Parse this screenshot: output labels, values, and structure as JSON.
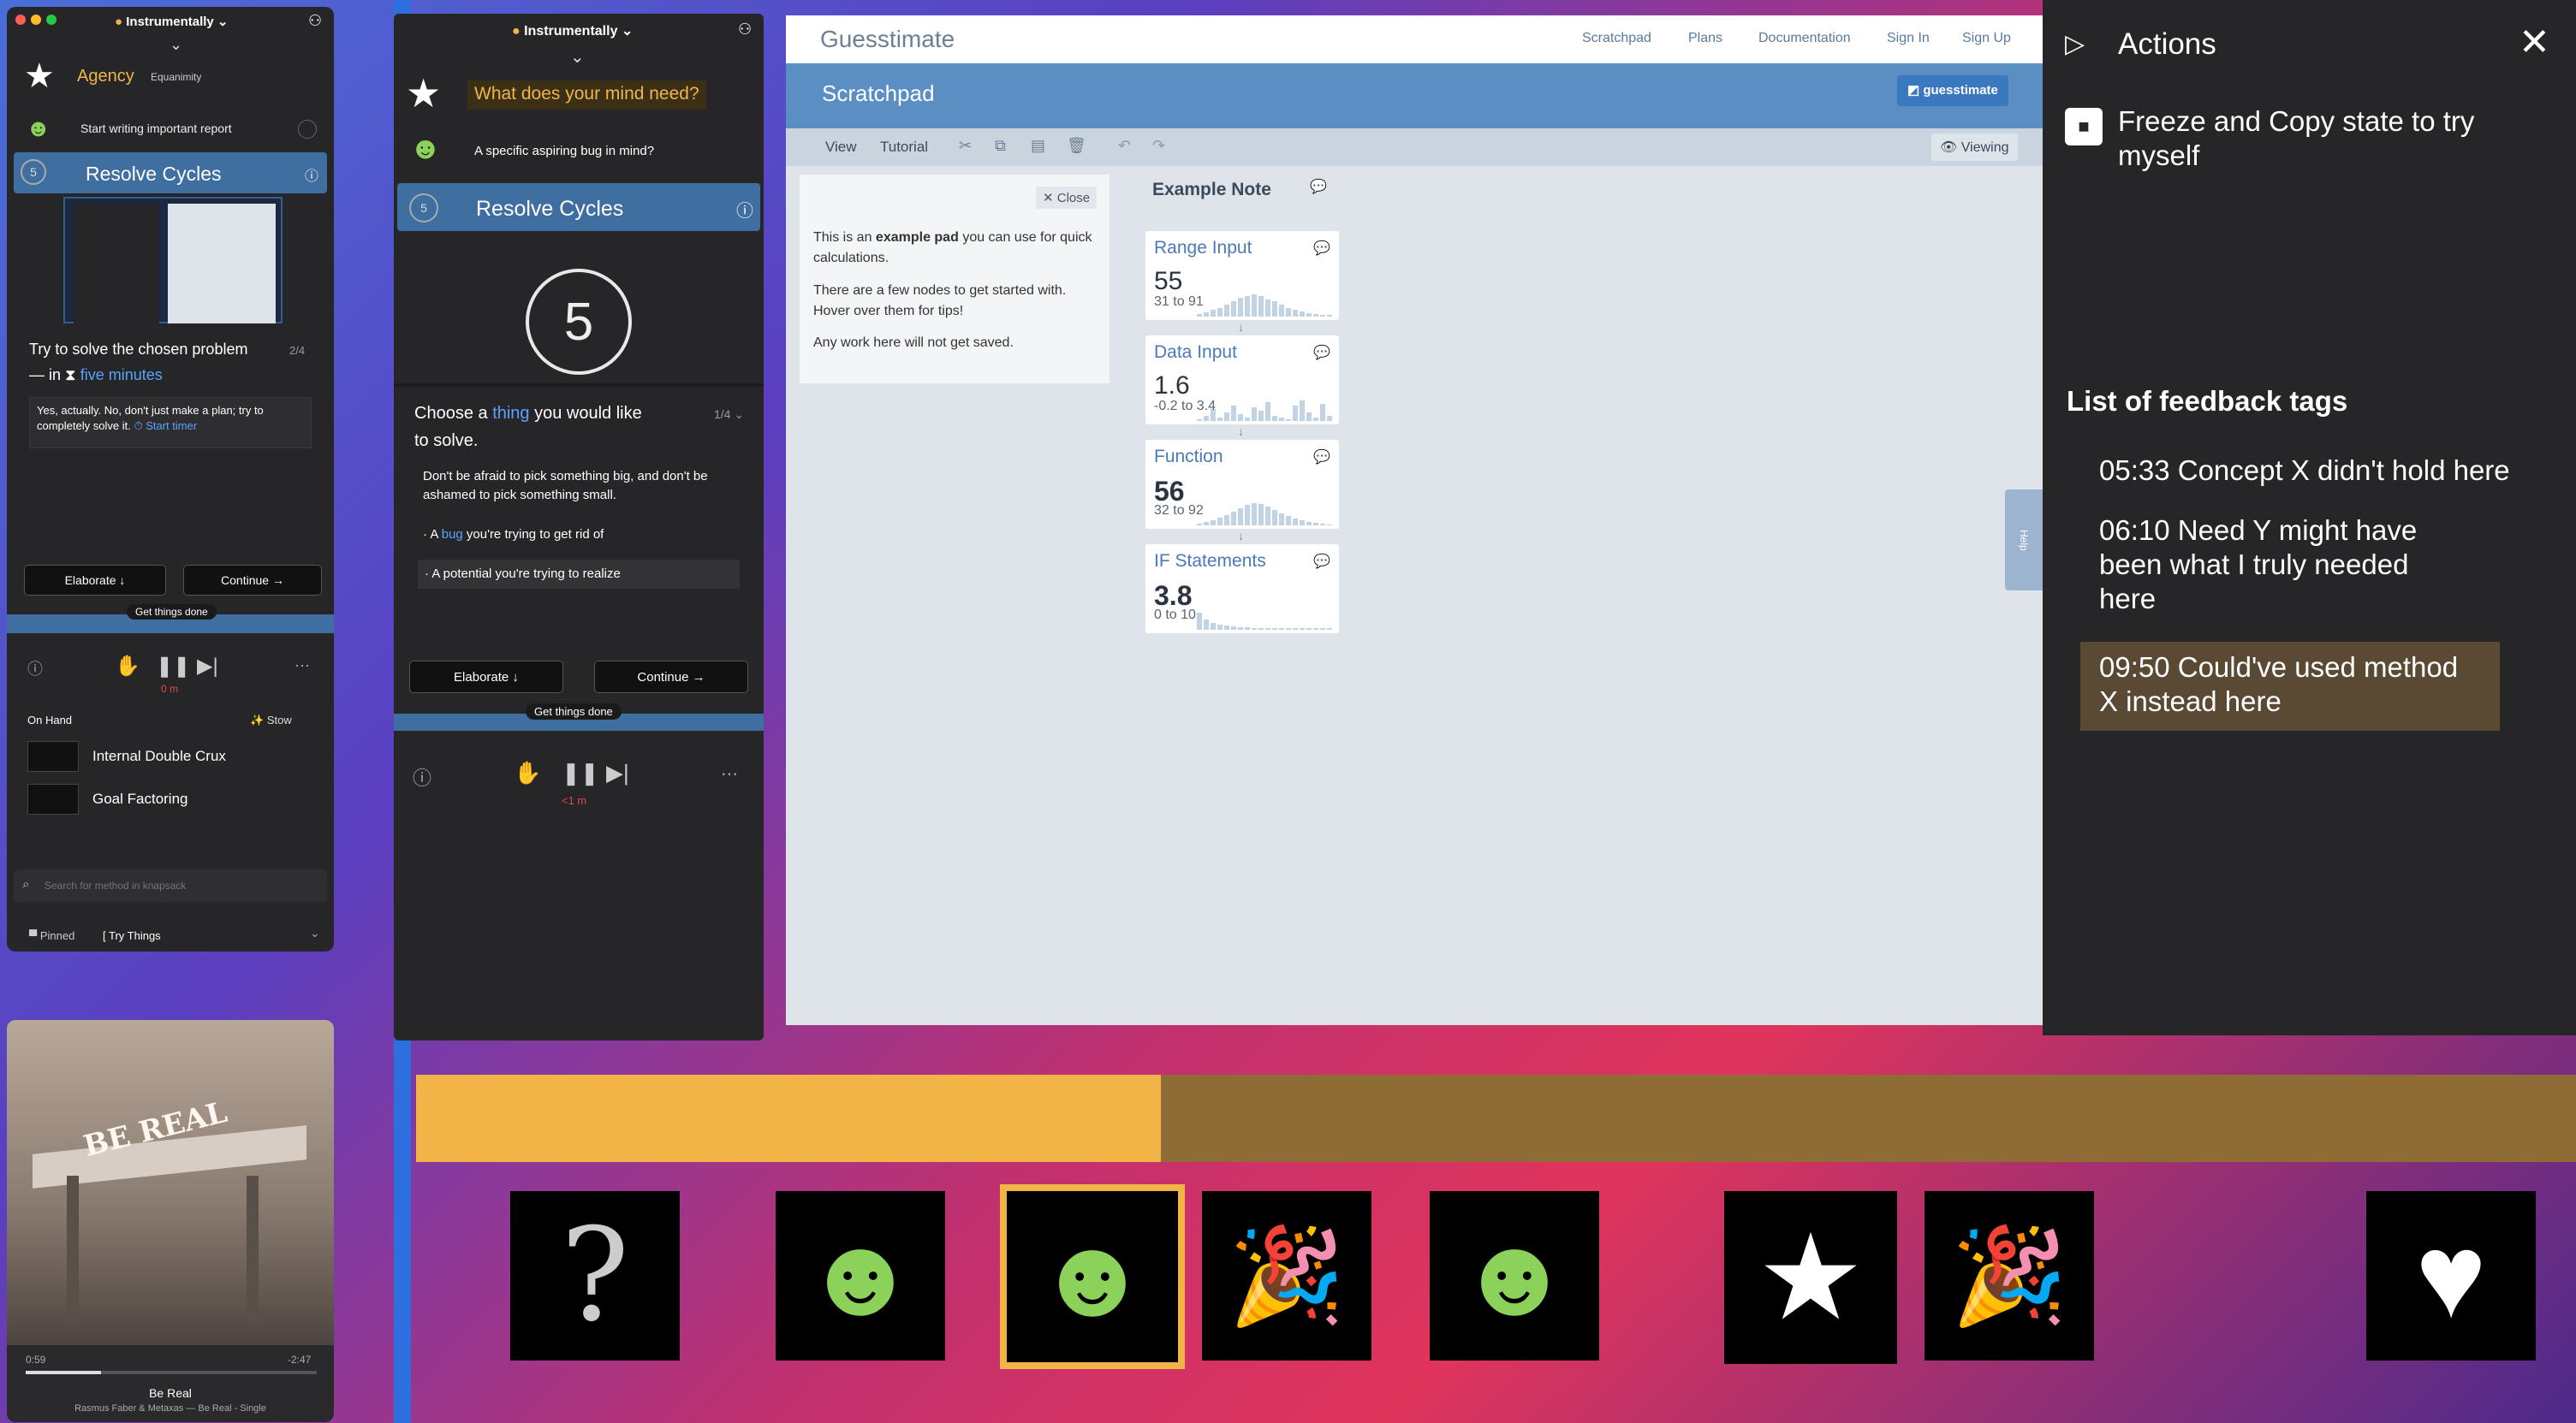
{
  "panel1": {
    "app_title": "Instrumentally",
    "tab_active": "Agency",
    "tab_other": "Equanimity",
    "start_item": "Start writing important report",
    "cycle_title": "Resolve Cycles",
    "problem_title": "Try to solve the chosen problem",
    "problem_counter": "2/4",
    "problem_in": "— in",
    "problem_time": "five minutes",
    "problem_note": "Yes, actually. No, don't just make a plan; try to completely solve it.",
    "start_timer": "Start timer",
    "elaborate": "Elaborate ↓",
    "continue": "Continue →",
    "get_things_done": "Get things done",
    "timer_text": "0 m",
    "on_hand": "On Hand",
    "stow": "Stow",
    "items": [
      "Internal Double Crux",
      "Goal Factoring"
    ],
    "search_placeholder": "Search for method in knapsack",
    "pinned": "Pinned",
    "try_things": "Try Things"
  },
  "panel2": {
    "app_title": "Instrumentally",
    "question": "What does your mind need?",
    "bug_prompt": "A specific aspiring bug in mind?",
    "cycle_title": "Resolve Cycles",
    "big_number": "5",
    "choose_pre": "Choose a",
    "choose_link": "thing",
    "choose_post": "you would like",
    "choose_line2": "to solve.",
    "counter": "1/4",
    "advice": "Don't be afraid to pick something big, and don't be ashamed to pick something small.",
    "opt1_pre": "· A",
    "opt1_link": "bug",
    "opt1_post": "you're trying to get rid of",
    "opt2": "· A potential you're trying to realize",
    "elaborate": "Elaborate ↓",
    "continue": "Continue →",
    "get_things_done": "Get things done",
    "timer_text": "<1 m"
  },
  "guesstimate": {
    "brand": "Guesstimate",
    "nav": [
      "Scratchpad",
      "Plans",
      "Documentation",
      "Sign In",
      "Sign Up"
    ],
    "page_title": "Scratchpad",
    "badge": "guesstimate",
    "toolbar": [
      "View",
      "Tutorial"
    ],
    "viewing": "Viewing",
    "close": "✕ Close",
    "note_p1_pre": "This is an",
    "note_p1_bold": "example pad",
    "note_p1_post": "you can use for quick calculations.",
    "note_p2": "There are a few nodes to get started with. Hover over them for tips!",
    "note_p3": "Any work here will not get saved.",
    "example_note": "Example Note",
    "help": "Help",
    "nodes": [
      {
        "title": "Range Input",
        "value": "55",
        "range": "31 to 91"
      },
      {
        "title": "Data Input",
        "value": "1.6",
        "range": "-0.2 to 3.4"
      },
      {
        "title": "Function",
        "value": "56",
        "range": "32 to 92"
      },
      {
        "title": "IF Statements",
        "value": "3.8",
        "range": "0 to 10"
      }
    ]
  },
  "actions": {
    "title": "Actions",
    "freeze": "Freeze and Copy state to try myself",
    "feedback_heading": "List of feedback tags",
    "tags": [
      "05:33 Concept X didn't hold here",
      "06:10 Need Y might have been what I truly needed here",
      "09:50 Could've used method X instead here"
    ],
    "highlight_color": "#5a4a33"
  },
  "progress": {
    "fraction": 0.345,
    "fill_color": "#f2b446",
    "track_color": "#8f6c36"
  },
  "music": {
    "cover_text": "BE REAL",
    "elapsed": "0:59",
    "remaining": "-2:47",
    "progress": 0.26,
    "track": "Be Real",
    "artist": "Rasmus Faber & Metaxas — Be Real - Single"
  },
  "thumbnails": [
    "question-mask-icon",
    "bug-pointing-icon",
    "bug-pointing-icon",
    "party-popper-icon",
    "bug-pointing-icon",
    "star-flower-icon",
    "party-popper-icon",
    "heart-mask-icon"
  ]
}
